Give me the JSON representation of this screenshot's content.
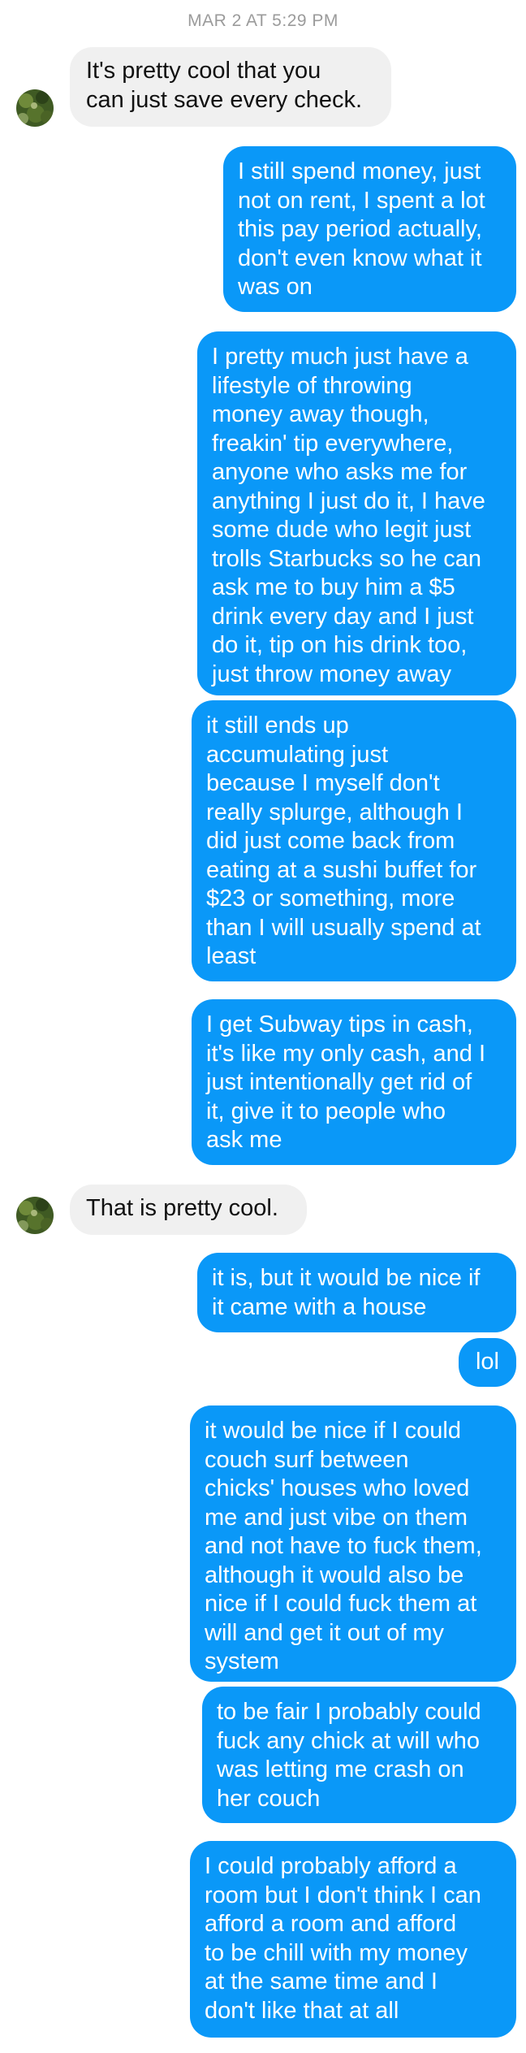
{
  "header": {
    "timestamp": "MAR 2 AT 5:29 PM"
  },
  "colors": {
    "outgoing_bubble": "#0a98f8",
    "incoming_bubble": "#f0f0f0",
    "timestamp_text": "#9b9b9b"
  },
  "avatar": {
    "icon": "contact-avatar-photo"
  },
  "messages": [
    {
      "sender": "them",
      "text": "It's pretty cool that you\ncan just save every check."
    },
    {
      "sender": "me",
      "text": "I still spend money, just\nnot on rent, I spent a lot\nthis pay period actually,\ndon't even know what it\nwas on"
    },
    {
      "sender": "me",
      "text": "I pretty much just have a\nlifestyle of throwing\nmoney away though,\nfreakin' tip everywhere,\nanyone who asks me for\nanything I just do it, I have\nsome dude who legit just\ntrolls Starbucks so he can\nask me to buy him a $5\ndrink every day and I just\ndo it, tip on his drink too,\njust throw money away"
    },
    {
      "sender": "me",
      "text": "it still ends up\naccumulating just\nbecause I myself don't\nreally splurge, although I\ndid just come back from\neating at a sushi buffet for\n$23 or something, more\nthan I will usually spend at\nleast"
    },
    {
      "sender": "me",
      "text": "I get Subway tips in cash,\nit's like my only cash, and I\njust intentionally get rid of\nit, give it to people who\nask me"
    },
    {
      "sender": "them",
      "text": "That is pretty cool."
    },
    {
      "sender": "me",
      "text": "it is, but it would be nice if\nit came with a house"
    },
    {
      "sender": "me",
      "text": "lol"
    },
    {
      "sender": "me",
      "text": "it would be nice if I could\ncouch surf between\nchicks' houses who loved\nme and just vibe on them\nand not have to fuck them,\nalthough it would also be\nnice if I could fuck them at\nwill and get it out of my\nsystem"
    },
    {
      "sender": "me",
      "text": "to be fair I probably could\nfuck any chick at will who\nwas letting me crash on\nher couch"
    },
    {
      "sender": "me",
      "text": "I could probably afford a\nroom but I don't think I can\nafford a room and afford\nto be chill with my money\nat the same time and I\ndon't like that at all"
    }
  ]
}
